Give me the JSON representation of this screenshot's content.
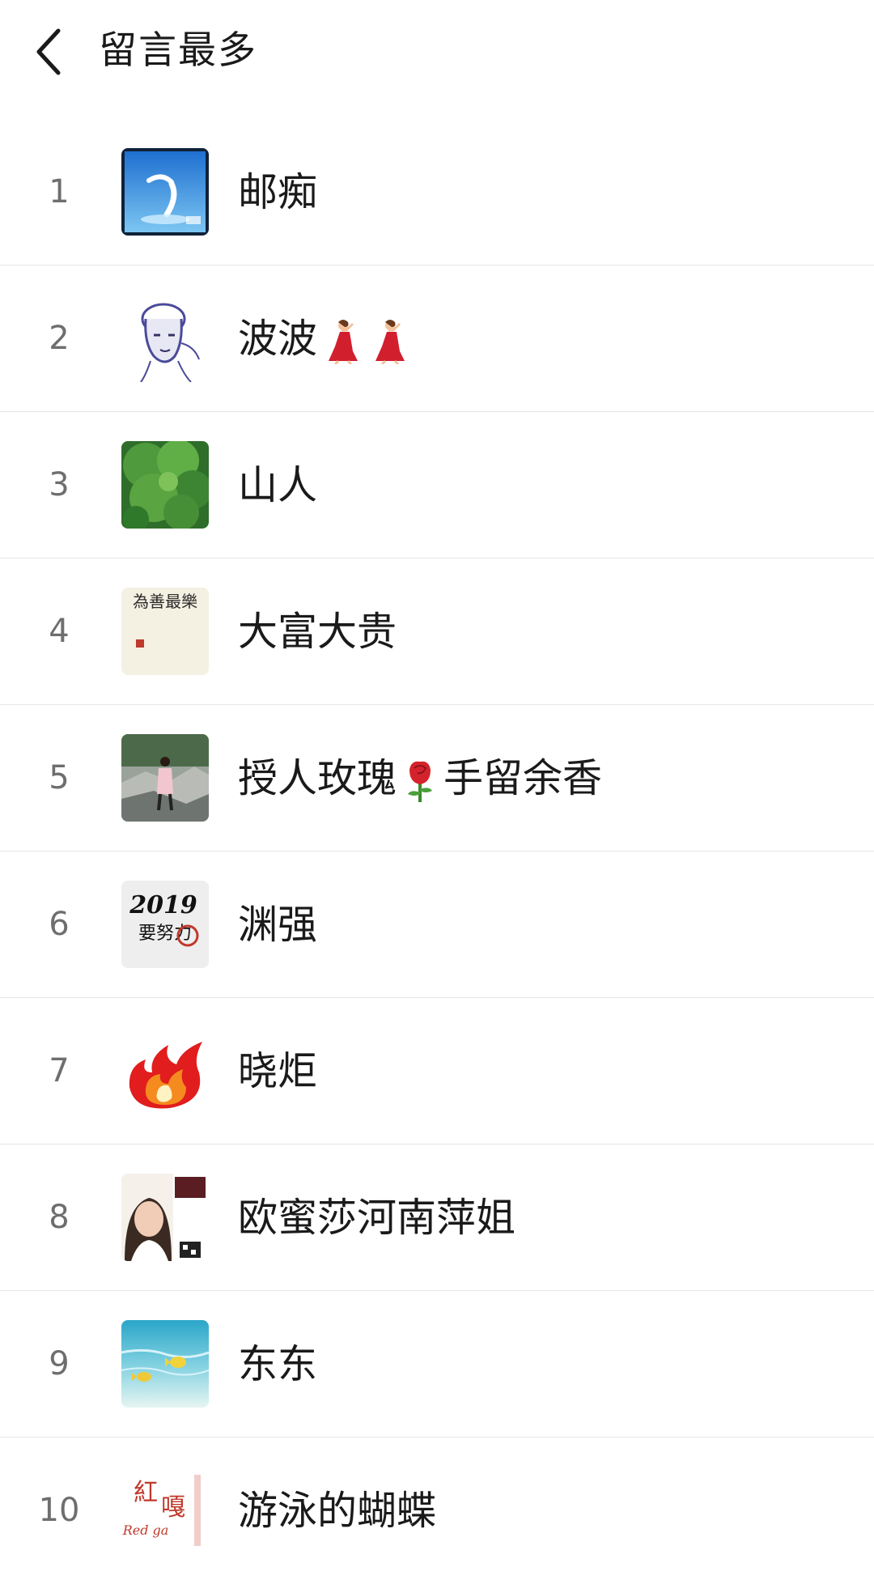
{
  "header": {
    "title": "留言最多"
  },
  "list": [
    {
      "rank": "1",
      "name": "邮痴",
      "avatar_icon": "water-stamp-avatar"
    },
    {
      "rank": "2",
      "name": "波波",
      "name_suffix_icons": [
        "dancer-emoji",
        "dancer-emoji"
      ],
      "avatar_icon": "sketch-portrait-avatar"
    },
    {
      "rank": "3",
      "name": "山人",
      "avatar_icon": "green-tree-avatar"
    },
    {
      "rank": "4",
      "name": "大富大贵",
      "avatar_icon": "calligraphy-avatar",
      "avatar_text": "為善最樂"
    },
    {
      "rank": "5",
      "name_before": "授人玫瑰",
      "name_after": "手留余香",
      "name_inline_icon": "rose-emoji",
      "avatar_icon": "person-on-rocks-avatar"
    },
    {
      "rank": "6",
      "name": "渊强",
      "avatar_icon": "new-year-calligraphy-avatar",
      "avatar_text": [
        "2019",
        "要努力"
      ]
    },
    {
      "rank": "7",
      "name": "晓炬",
      "avatar_icon": "flame-avatar"
    },
    {
      "rank": "8",
      "name": "欧蜜莎河南萍姐",
      "avatar_icon": "woman-portrait-avatar"
    },
    {
      "rank": "9",
      "name": "东东",
      "avatar_icon": "tropical-fish-avatar"
    },
    {
      "rank": "10",
      "name": "游泳的蝴蝶",
      "avatar_icon": "red-brand-logo-avatar",
      "avatar_text": [
        "紅",
        "嘎",
        "Red ga"
      ]
    }
  ],
  "colors": {
    "text": "#1a1a1a",
    "rank": "#6e6e6e",
    "divider": "#e6e6e6",
    "background": "#ffffff"
  }
}
